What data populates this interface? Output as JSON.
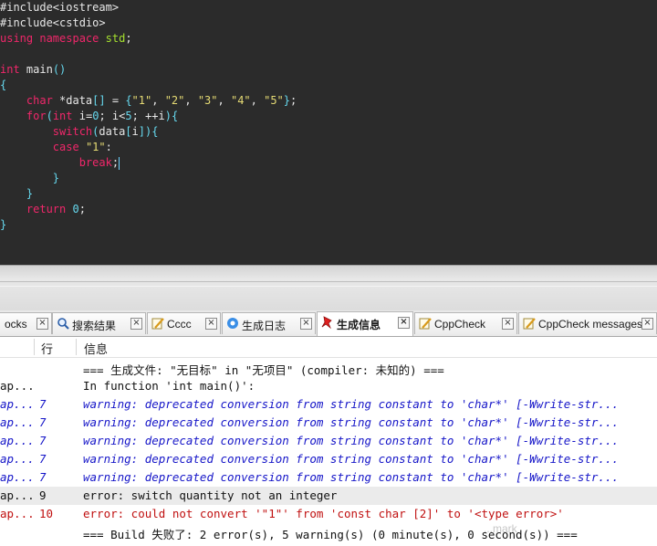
{
  "editor": {
    "lines": [
      [
        {
          "t": "#include<iostream>",
          "c": "c-pp"
        }
      ],
      [
        {
          "t": "#include<cstdio>",
          "c": "c-pp"
        }
      ],
      [
        {
          "t": "using",
          "c": "c-kw"
        },
        {
          "t": " ",
          "c": "c-id"
        },
        {
          "t": "namespace",
          "c": "c-kw"
        },
        {
          "t": " ",
          "c": "c-id"
        },
        {
          "t": "std",
          "c": "c-ns"
        },
        {
          "t": ";",
          "c": "c-op"
        }
      ],
      [],
      [
        {
          "t": "int",
          "c": "c-ty"
        },
        {
          "t": " main",
          "c": "c-id"
        },
        {
          "t": "()",
          "c": "c-br"
        }
      ],
      [
        {
          "t": "{",
          "c": "c-br"
        }
      ],
      [
        {
          "t": "    ",
          "c": "c-id"
        },
        {
          "t": "char",
          "c": "c-ty"
        },
        {
          "t": " *data",
          "c": "c-id"
        },
        {
          "t": "[]",
          "c": "c-br"
        },
        {
          "t": " = ",
          "c": "c-op"
        },
        {
          "t": "{",
          "c": "c-br"
        },
        {
          "t": "\"1\"",
          "c": "c-str"
        },
        {
          "t": ", ",
          "c": "c-op"
        },
        {
          "t": "\"2\"",
          "c": "c-str"
        },
        {
          "t": ", ",
          "c": "c-op"
        },
        {
          "t": "\"3\"",
          "c": "c-str"
        },
        {
          "t": ", ",
          "c": "c-op"
        },
        {
          "t": "\"4\"",
          "c": "c-str"
        },
        {
          "t": ", ",
          "c": "c-op"
        },
        {
          "t": "\"5\"",
          "c": "c-str"
        },
        {
          "t": "}",
          "c": "c-br"
        },
        {
          "t": ";",
          "c": "c-op"
        }
      ],
      [
        {
          "t": "    ",
          "c": "c-id"
        },
        {
          "t": "for",
          "c": "c-kw"
        },
        {
          "t": "(",
          "c": "c-br"
        },
        {
          "t": "int",
          "c": "c-ty"
        },
        {
          "t": " i=",
          "c": "c-id"
        },
        {
          "t": "0",
          "c": "c-num"
        },
        {
          "t": "; i<",
          "c": "c-id"
        },
        {
          "t": "5",
          "c": "c-num"
        },
        {
          "t": "; ++i",
          "c": "c-id"
        },
        {
          "t": ")",
          "c": "c-br"
        },
        {
          "t": "{",
          "c": "c-br"
        }
      ],
      [
        {
          "t": "        ",
          "c": "c-id"
        },
        {
          "t": "switch",
          "c": "c-kw"
        },
        {
          "t": "(",
          "c": "c-br"
        },
        {
          "t": "data",
          "c": "c-id"
        },
        {
          "t": "[",
          "c": "c-br"
        },
        {
          "t": "i",
          "c": "c-id"
        },
        {
          "t": "])",
          "c": "c-br"
        },
        {
          "t": "{",
          "c": "c-br"
        }
      ],
      [
        {
          "t": "        ",
          "c": "c-id"
        },
        {
          "t": "case",
          "c": "c-kw"
        },
        {
          "t": " ",
          "c": "c-id"
        },
        {
          "t": "\"1\"",
          "c": "c-str"
        },
        {
          "t": ":",
          "c": "c-op"
        }
      ],
      [
        {
          "t": "            ",
          "c": "c-id"
        },
        {
          "t": "break",
          "c": "c-kw"
        },
        {
          "t": ";",
          "c": "c-op"
        },
        {
          "t": "|",
          "c": "caret"
        }
      ],
      [
        {
          "t": "        ",
          "c": "c-id"
        },
        {
          "t": "}",
          "c": "c-br"
        }
      ],
      [
        {
          "t": "    ",
          "c": "c-id"
        },
        {
          "t": "}",
          "c": "c-br"
        }
      ],
      [
        {
          "t": "    ",
          "c": "c-id"
        },
        {
          "t": "return",
          "c": "c-kw"
        },
        {
          "t": " ",
          "c": "c-id"
        },
        {
          "t": "0",
          "c": "c-num"
        },
        {
          "t": ";",
          "c": "c-op"
        }
      ],
      [
        {
          "t": "}",
          "c": "c-br"
        }
      ]
    ]
  },
  "tabs": [
    {
      "label": "ocks",
      "icon": "none",
      "active": false
    },
    {
      "label": "搜索结果",
      "icon": "magnifier-icon",
      "active": false
    },
    {
      "label": "Cccc",
      "icon": "pencil-note-icon",
      "active": false
    },
    {
      "label": "生成日志",
      "icon": "gear-log-icon",
      "active": false
    },
    {
      "label": "生成信息",
      "icon": "pin-icon",
      "active": true
    },
    {
      "label": "CppCheck",
      "icon": "pencil-note-icon",
      "active": false
    },
    {
      "label": "CppCheck messages",
      "icon": "pencil-note-icon",
      "active": false
    }
  ],
  "messages": {
    "headers": {
      "file": "",
      "line": "行",
      "message": "信息"
    },
    "rows": [
      {
        "file": "",
        "line": "",
        "message": "=== 生成文件: \"无目标\" in \"无项目\" (compiler: 未知的) ===",
        "kind": "plain"
      },
      {
        "file": "ap...",
        "line": "",
        "message": "In function 'int main()':",
        "kind": "plain"
      },
      {
        "file": "ap...",
        "line": "7",
        "message": "warning: deprecated conversion from string constant to 'char*' [-Wwrite-str...",
        "kind": "warn"
      },
      {
        "file": "ap...",
        "line": "7",
        "message": "warning: deprecated conversion from string constant to 'char*' [-Wwrite-str...",
        "kind": "warn"
      },
      {
        "file": "ap...",
        "line": "7",
        "message": "warning: deprecated conversion from string constant to 'char*' [-Wwrite-str...",
        "kind": "warn"
      },
      {
        "file": "ap...",
        "line": "7",
        "message": "warning: deprecated conversion from string constant to 'char*' [-Wwrite-str...",
        "kind": "warn"
      },
      {
        "file": "ap...",
        "line": "7",
        "message": "warning: deprecated conversion from string constant to 'char*' [-Wwrite-str...",
        "kind": "warn"
      },
      {
        "file": "ap...",
        "line": "9",
        "message": "error: switch quantity not an integer",
        "kind": "plain",
        "highlight": true
      },
      {
        "file": "ap...",
        "line": "10",
        "message": "error: could not convert '\"1\"' from 'const char [2]' to '<type error>'",
        "kind": "err"
      },
      {
        "file": "",
        "line": "",
        "message": "=== Build 失败了: 2 error(s), 5 warning(s) (0 minute(s), 0 second(s)) ===",
        "kind": "plain"
      }
    ],
    "watermark": "...mark"
  }
}
